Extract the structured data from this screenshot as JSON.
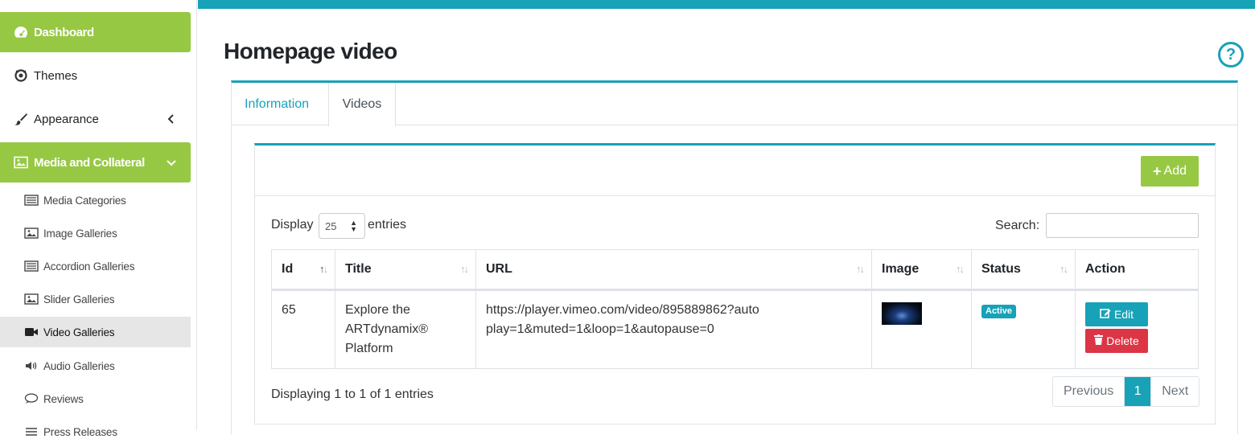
{
  "sidebar": {
    "items": [
      {
        "label": "Dashboard",
        "icon": "dashboard-icon"
      },
      {
        "label": "Themes",
        "icon": "themes-icon"
      },
      {
        "label": "Appearance",
        "icon": "brush-icon"
      },
      {
        "label": "Media and Collateral",
        "icon": "image-icon"
      }
    ],
    "subitems": [
      {
        "label": "Media Categories",
        "icon": "list-icon"
      },
      {
        "label": "Image Galleries",
        "icon": "image-icon"
      },
      {
        "label": "Accordion Galleries",
        "icon": "list-icon"
      },
      {
        "label": "Slider Galleries",
        "icon": "image-icon"
      },
      {
        "label": "Video Galleries",
        "icon": "video-icon"
      },
      {
        "label": "Audio Galleries",
        "icon": "volume-icon"
      },
      {
        "label": "Reviews",
        "icon": "comment-icon"
      },
      {
        "label": "Press Releases",
        "icon": "list-icon"
      }
    ]
  },
  "page": {
    "title": "Homepage video",
    "help": "?"
  },
  "tabs": [
    {
      "label": "Information"
    },
    {
      "label": "Videos"
    }
  ],
  "toolbar": {
    "add_label": "Add"
  },
  "datatable": {
    "display_label": "Display",
    "length_value": "25",
    "entries_label": "entries",
    "search_label": "Search:",
    "columns": [
      "Id",
      "Title",
      "URL",
      "Image",
      "Status",
      "Action"
    ],
    "rows": [
      {
        "id": "65",
        "title": "Explore the ARTdynamix® Platform",
        "url": "https://player.vimeo.com/video/895889862?autoplay=1&muted=1&loop=1&autopause=0",
        "status": "Active",
        "edit_label": "Edit",
        "delete_label": "Delete"
      }
    ],
    "info": "Displaying 1 to 1 of 1 entries",
    "pager": {
      "previous": "Previous",
      "current": "1",
      "next": "Next"
    }
  },
  "colors": {
    "accent": "#17a2b8",
    "brand_green": "#97c843",
    "danger": "#dc3545"
  }
}
